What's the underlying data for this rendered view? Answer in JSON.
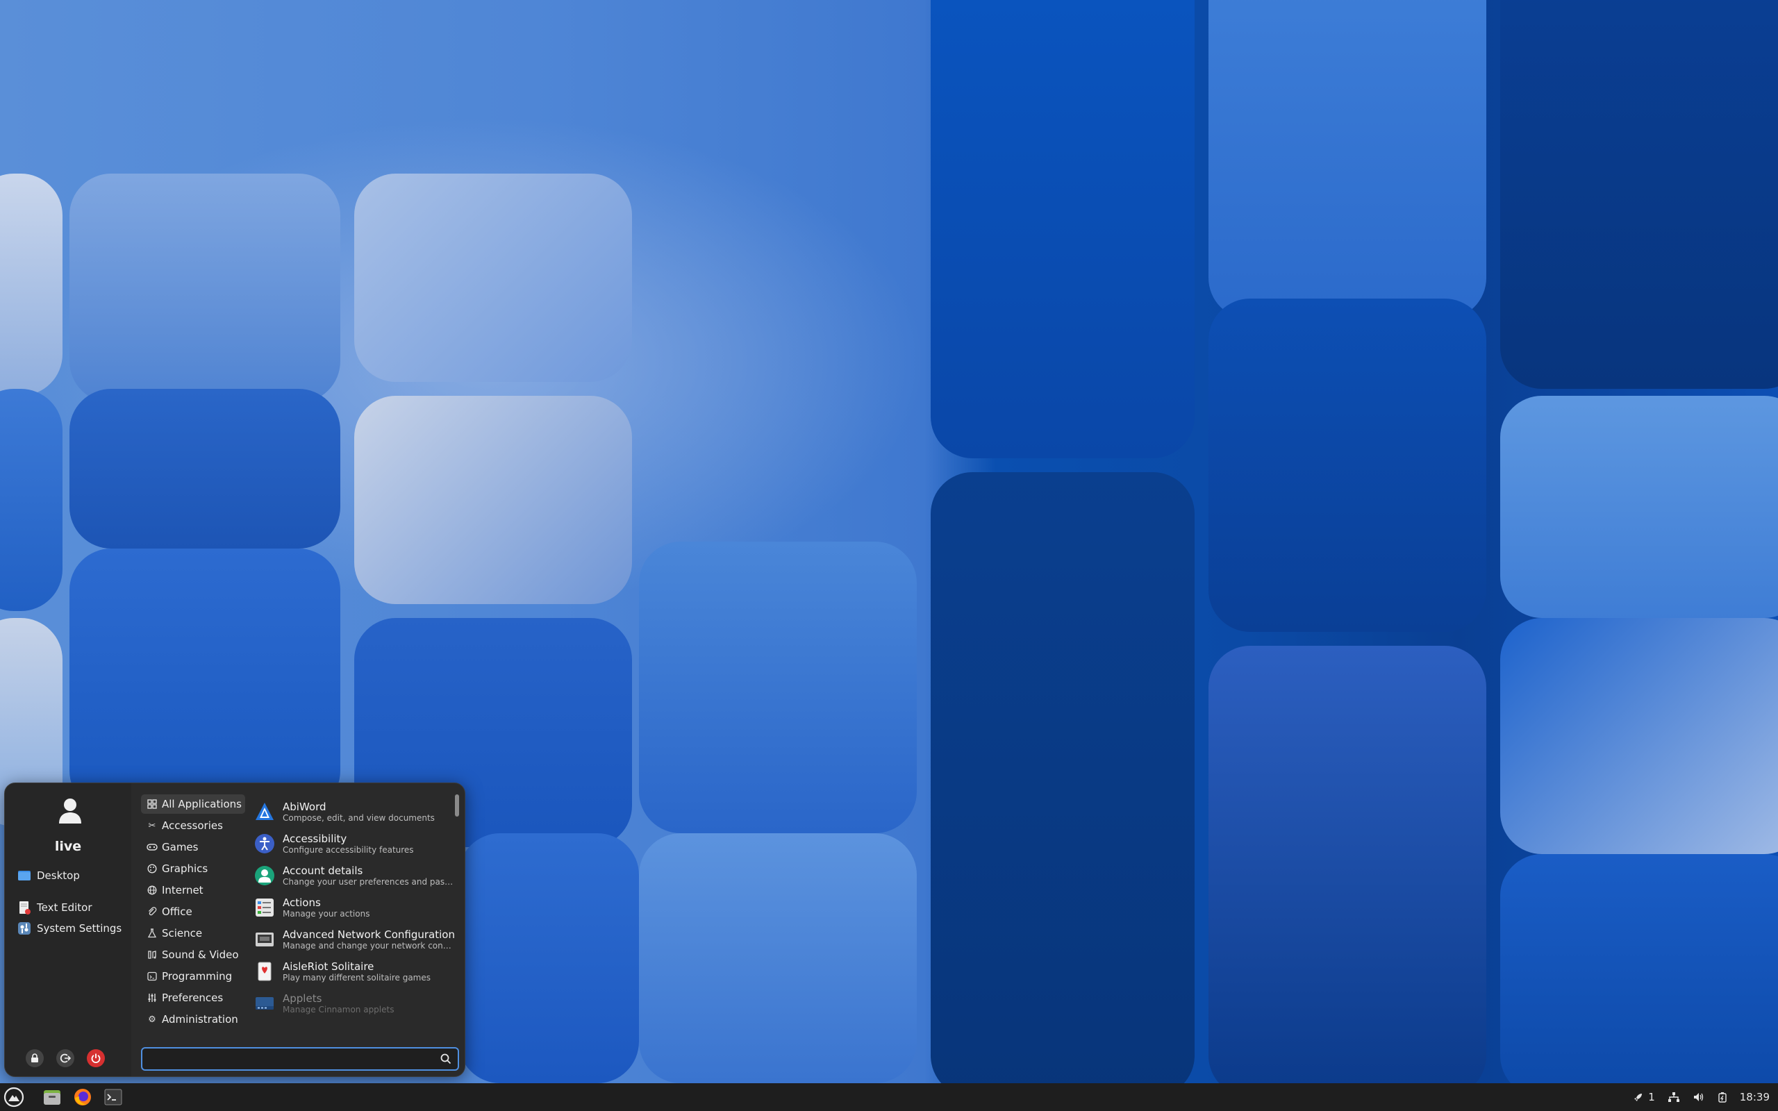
{
  "menu": {
    "username": "live",
    "favorites": [
      {
        "label": "Desktop",
        "icon": "folder-icon"
      },
      {
        "label": "Text Editor",
        "icon": "text-editor-icon"
      },
      {
        "label": "System Settings",
        "icon": "settings-icon"
      }
    ],
    "categories": [
      {
        "label": "All Applications",
        "icon": "grid-icon",
        "selected": true
      },
      {
        "label": "Accessories",
        "icon": "tools-icon"
      },
      {
        "label": "Games",
        "icon": "gamepad-icon"
      },
      {
        "label": "Graphics",
        "icon": "palette-icon"
      },
      {
        "label": "Internet",
        "icon": "globe-icon"
      },
      {
        "label": "Office",
        "icon": "paperclip-icon"
      },
      {
        "label": "Science",
        "icon": "flask-icon"
      },
      {
        "label": "Sound & Video",
        "icon": "music-icon"
      },
      {
        "label": "Programming",
        "icon": "code-icon"
      },
      {
        "label": "Preferences",
        "icon": "sliders-icon"
      },
      {
        "label": "Administration",
        "icon": "gear-icon"
      }
    ],
    "apps": [
      {
        "name": "AbiWord",
        "desc": "Compose, edit, and view documents",
        "icon": "abiword-icon",
        "color": "#1f6fd6"
      },
      {
        "name": "Accessibility",
        "desc": "Configure accessibility features",
        "icon": "accessibility-icon",
        "color": "#3b5fc6"
      },
      {
        "name": "Account details",
        "desc": "Change your user preferences and pass...",
        "icon": "account-icon",
        "color": "#1aa37a"
      },
      {
        "name": "Actions",
        "desc": "Manage your actions",
        "icon": "actions-icon",
        "color": "#dcdcdc"
      },
      {
        "name": "Advanced Network Configuration",
        "desc": "Manage and change your network conne...",
        "icon": "network-icon",
        "color": "#cfcfcf"
      },
      {
        "name": "AisleRiot Solitaire",
        "desc": "Play many different solitaire games",
        "icon": "cards-icon",
        "color": "#f2f2f2"
      },
      {
        "name": "Applets",
        "desc": "Manage Cinnamon applets",
        "icon": "applets-icon",
        "color": "#2e6fc0"
      }
    ],
    "search_value": ""
  },
  "panel": {
    "workspace_count": "1",
    "clock": "18:39"
  },
  "colors": {
    "accent": "#4f8fe0",
    "menu_bg": "#2a2a2a",
    "panel_bg": "#1e1e1e",
    "power_red": "#d63030"
  }
}
